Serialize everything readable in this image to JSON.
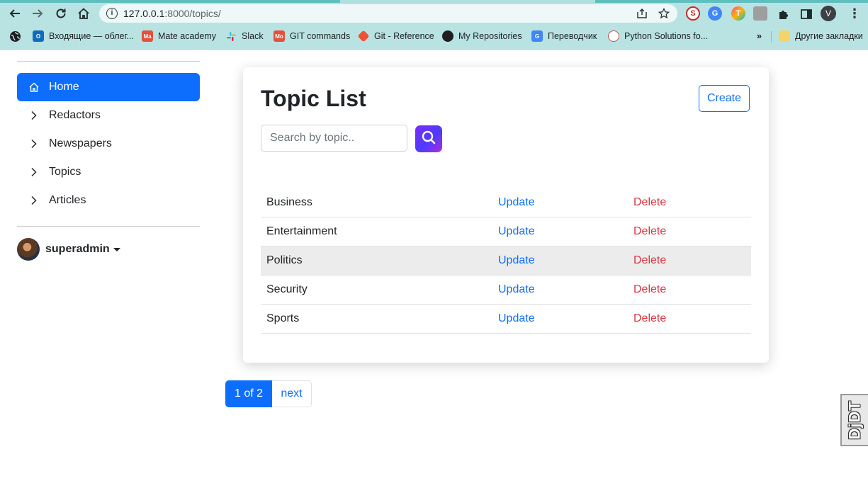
{
  "browser": {
    "url_host": "127.0.0.1",
    "url_path": ":8000/topics/",
    "profile_initial": "V",
    "bookmarks": [
      {
        "label": "Входящие — облег...",
        "icon": "outlook-icon",
        "color": "#0f6cbd"
      },
      {
        "label": "Mate academy",
        "icon": "mate-academy-icon",
        "color": "#e2513a"
      },
      {
        "label": "Slack",
        "icon": "slack-icon",
        "color": "#4a154b"
      },
      {
        "label": "GIT commands",
        "icon": "git-commands-icon",
        "color": "#e2513a"
      },
      {
        "label": "Git - Reference",
        "icon": "git-icon",
        "color": "#f05133"
      },
      {
        "label": "My Repositories",
        "icon": "github-icon",
        "color": "#1f1f1f"
      },
      {
        "label": "Переводчик",
        "icon": "google-translate-icon",
        "color": "#4285f4"
      },
      {
        "label": "Python Solutions fo...",
        "icon": "python-solutions-icon",
        "color": "#c94f4f"
      }
    ],
    "more_bookmarks": "»",
    "other_bookmarks": "Другие закладки"
  },
  "sidebar": {
    "items": [
      {
        "label": "Home",
        "icon": "home-icon",
        "active": true
      },
      {
        "label": "Redactors",
        "icon": "chevron-right-icon",
        "active": false
      },
      {
        "label": "Newspapers",
        "icon": "chevron-right-icon",
        "active": false
      },
      {
        "label": "Topics",
        "icon": "chevron-right-icon",
        "active": false
      },
      {
        "label": "Articles",
        "icon": "chevron-right-icon",
        "active": false
      }
    ],
    "user": {
      "name": "superadmin"
    }
  },
  "main": {
    "title": "Topic List",
    "create_label": "Create",
    "search": {
      "placeholder": "Search by topic.."
    },
    "rows": [
      {
        "name": "Business",
        "update": "Update",
        "delete": "Delete"
      },
      {
        "name": "Entertainment",
        "update": "Update",
        "delete": "Delete"
      },
      {
        "name": "Politics",
        "update": "Update",
        "delete": "Delete"
      },
      {
        "name": "Security",
        "update": "Update",
        "delete": "Delete"
      },
      {
        "name": "Sports",
        "update": "Update",
        "delete": "Delete"
      }
    ],
    "pagination": {
      "current": "1 of 2",
      "next": "next"
    }
  },
  "debug_toolbar": {
    "label": "DjDT"
  },
  "colors": {
    "primary": "#0d6efd",
    "danger": "#dc3545",
    "chrome": "#b9e3e3"
  }
}
